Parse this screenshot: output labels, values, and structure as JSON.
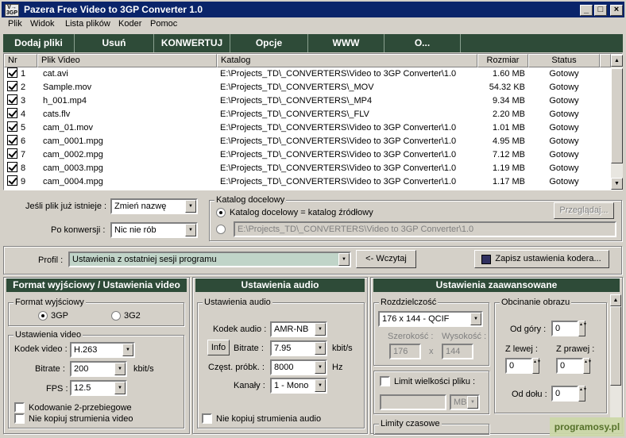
{
  "window": {
    "title": "Pazera Free Video to 3GP Converter 1.0",
    "icon_text": "V→\n3GP",
    "min": "_",
    "max": "□",
    "close": "×"
  },
  "menu": [
    "Plik",
    "Widok",
    "Lista plików",
    "Koder",
    "Pomoc"
  ],
  "toolbar": [
    "Dodaj pliki",
    "Usuń",
    "KONWERTUJ",
    "Opcje",
    "WWW",
    "O..."
  ],
  "list": {
    "headers": {
      "nr": "Nr",
      "file": "Plik Video",
      "dir": "Katalog",
      "size": "Rozmiar",
      "status": "Status"
    },
    "rows": [
      {
        "nr": "1",
        "file": "cat.avi",
        "dir": "E:\\Projects_TD\\_CONVERTERS\\Video to 3GP Converter\\1.0",
        "size": "1.60 MB",
        "status": "Gotowy"
      },
      {
        "nr": "2",
        "file": "Sample.mov",
        "dir": "E:\\Projects_TD\\_CONVERTERS\\_MOV",
        "size": "54.32 KB",
        "status": "Gotowy"
      },
      {
        "nr": "3",
        "file": "h_001.mp4",
        "dir": "E:\\Projects_TD\\_CONVERTERS\\_MP4",
        "size": "9.34 MB",
        "status": "Gotowy"
      },
      {
        "nr": "4",
        "file": "cats.flv",
        "dir": "E:\\Projects_TD\\_CONVERTERS\\_FLV",
        "size": "2.20 MB",
        "status": "Gotowy"
      },
      {
        "nr": "5",
        "file": "cam_01.mov",
        "dir": "E:\\Projects_TD\\_CONVERTERS\\Video to 3GP Converter\\1.0",
        "size": "1.01 MB",
        "status": "Gotowy"
      },
      {
        "nr": "6",
        "file": "cam_0001.mpg",
        "dir": "E:\\Projects_TD\\_CONVERTERS\\Video to 3GP Converter\\1.0",
        "size": "4.95 MB",
        "status": "Gotowy"
      },
      {
        "nr": "7",
        "file": "cam_0002.mpg",
        "dir": "E:\\Projects_TD\\_CONVERTERS\\Video to 3GP Converter\\1.0",
        "size": "7.12 MB",
        "status": "Gotowy"
      },
      {
        "nr": "8",
        "file": "cam_0003.mpg",
        "dir": "E:\\Projects_TD\\_CONVERTERS\\Video to 3GP Converter\\1.0",
        "size": "1.19 MB",
        "status": "Gotowy"
      },
      {
        "nr": "9",
        "file": "cam_0004.mpg",
        "dir": "E:\\Projects_TD\\_CONVERTERS\\Video to 3GP Converter\\1.0",
        "size": "1.17 MB",
        "status": "Gotowy"
      }
    ]
  },
  "exists": {
    "label": "Jeśli plik już istnieje :",
    "value": "Zmień nazwę"
  },
  "after": {
    "label": "Po konwersji :",
    "value": "Nic nie rób"
  },
  "target": {
    "title": "Katalog docelowy",
    "opt1": "Katalog docelowy = katalog źródłowy",
    "path": "E:\\Projects_TD\\_CONVERTERS\\Video to 3GP Converter\\1.0",
    "browse": "Przeglądaj..."
  },
  "profile": {
    "label": "Profil :",
    "value": "Ustawienia z ostatniej sesji programu",
    "load": "<- Wczytaj",
    "save": "Zapisz ustawienia kodera..."
  },
  "video": {
    "header": "Format wyjściowy / Ustawienia video",
    "format_title": "Format wyjściowy",
    "fmt1": "3GP",
    "fmt2": "3G2",
    "settings_title": "Ustawienia video",
    "codec_label": "Kodek video :",
    "codec": "H.263",
    "bitrate_label": "Bitrate :",
    "bitrate": "200",
    "bitrate_unit": "kbit/s",
    "fps_label": "FPS :",
    "fps": "12.5",
    "twopass": "Kodowanie 2-przebiegowe",
    "nocopy": "Nie kopiuj strumienia video"
  },
  "audio": {
    "header": "Ustawienia audio",
    "title": "Ustawienia audio",
    "codec_label": "Kodek audio :",
    "codec": "AMR-NB",
    "info": "Info",
    "bitrate_label": "Bitrate :",
    "bitrate": "7.95",
    "bitrate_unit": "kbit/s",
    "freq_label": "Częst. próbk. :",
    "freq": "8000",
    "freq_unit": "Hz",
    "channels_label": "Kanały :",
    "channels": "1 - Mono",
    "nocopy": "Nie kopiuj strumienia audio"
  },
  "advanced": {
    "header": "Ustawienia zaawansowane",
    "res_title": "Rozdzielczość",
    "res": "176 x 144 - QCIF",
    "width_label": "Szerokość :",
    "height_label": "Wysokość :",
    "width": "176",
    "height": "144",
    "x": "x",
    "limit_label": "Limit wielkości pliku :",
    "limit_unit": "MB",
    "time_title": "Limity czasowe",
    "crop_title": "Obcinanie obrazu",
    "top_label": "Od góry :",
    "top": "0",
    "left_label": "Z lewej :",
    "left": "0",
    "right_label": "Z prawej :",
    "right": "0",
    "bottom_label": "Od dołu :",
    "bottom": "0"
  },
  "watermark": "programosy.pl"
}
